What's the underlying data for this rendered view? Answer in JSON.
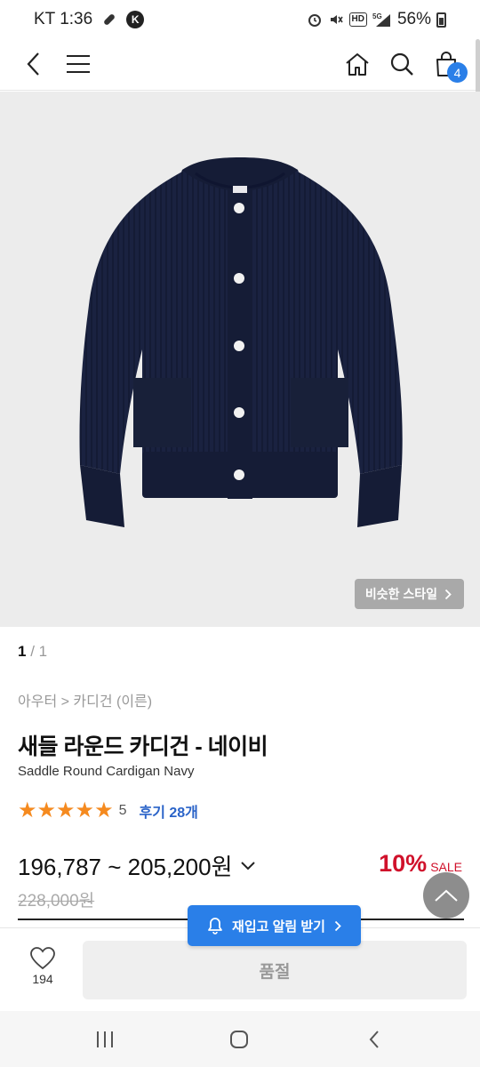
{
  "status": {
    "carrier_time": "KT 1:36",
    "battery": "56%"
  },
  "nav": {
    "cart_count": "4"
  },
  "image": {
    "similar_label": "비슷한 스타일"
  },
  "pager": {
    "current": "1",
    "separator": " / ",
    "total": "1"
  },
  "product": {
    "breadcrumb": "아우터 > 카디건 (이른)",
    "title": "새들 라운드 카디건 - 네이비",
    "subtitle": "Saddle Round Cardigan Navy",
    "stars": "★★★★★",
    "rating": "5",
    "reviews": "후기 28개",
    "price": "196,787 ~ 205,200원",
    "original_price": "228,000원",
    "discount": "10%",
    "sale_label": "SALE"
  },
  "bottom": {
    "likes": "194",
    "soldout_label": "품절",
    "restock_label": "재입고 알림 받기"
  },
  "colors": {
    "accent": "#2a7fe8",
    "sale": "#d0112b",
    "star": "#f58a1f",
    "garment": "#1a2240"
  }
}
